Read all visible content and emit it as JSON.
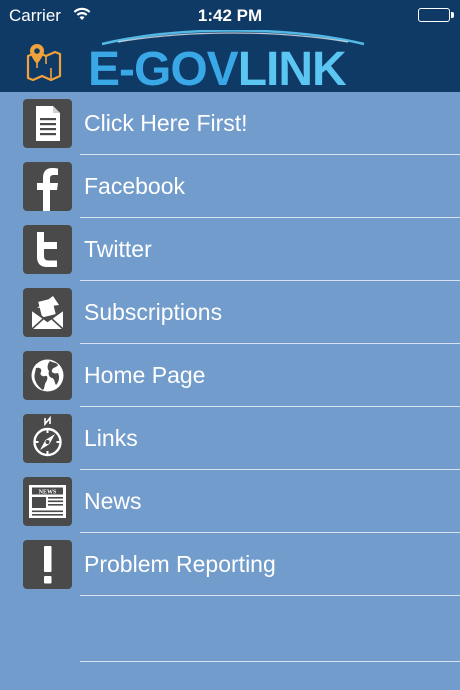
{
  "status_bar": {
    "carrier": "Carrier",
    "time": "1:42 PM"
  },
  "header": {
    "logo_part1": "E-GOV",
    "logo_part2": "LINK",
    "map_icon": "map-pin-icon"
  },
  "colors": {
    "header_bg": "#0f3a66",
    "page_bg": "#729ccb",
    "icon_bg": "#4a4a4a",
    "logo_accent": "#3aa7e6",
    "map_icon_color": "#f1a23a"
  },
  "menu": [
    {
      "label": "Click Here First!",
      "icon": "document-icon"
    },
    {
      "label": "Facebook",
      "icon": "facebook-icon"
    },
    {
      "label": "Twitter",
      "icon": "twitter-icon"
    },
    {
      "label": "Subscriptions",
      "icon": "envelope-icon"
    },
    {
      "label": "Home Page",
      "icon": "globe-icon"
    },
    {
      "label": "Links",
      "icon": "compass-icon"
    },
    {
      "label": "News",
      "icon": "newspaper-icon"
    },
    {
      "label": "Problem Reporting",
      "icon": "exclamation-icon"
    }
  ]
}
